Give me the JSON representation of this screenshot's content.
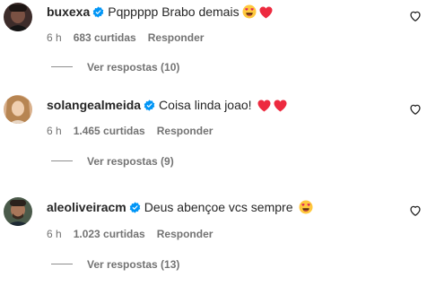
{
  "comments": [
    {
      "username": "buxexa",
      "text": "Pqppppp Brabo demais",
      "emojis": [
        "smiling-face-with-heart-eyes",
        "red-heart"
      ],
      "time": "6 h",
      "likes": "683 curtidas",
      "reply_label": "Responder",
      "view_replies": "Ver respostas (10)"
    },
    {
      "username": "solangealmeida",
      "text": "Coisa linda joao!",
      "emojis": [
        "red-heart",
        "red-heart"
      ],
      "time": "6 h",
      "likes": "1.465 curtidas",
      "reply_label": "Responder",
      "view_replies": "Ver respostas (9)"
    },
    {
      "username": "aleoliveiracm",
      "text": "Deus abençoe vcs sempre",
      "emojis": [
        "smiling-face-with-heart-eyes"
      ],
      "time": "6 h",
      "likes": "1.023 curtidas",
      "reply_label": "Responder",
      "view_replies": "Ver respostas (13)"
    }
  ],
  "colors": {
    "verified": "#0095f6",
    "heart": "#ed2a3f",
    "secondary_text": "#737373"
  },
  "icons": {
    "verified": "verified-badge-icon",
    "like": "heart-outline-icon"
  }
}
